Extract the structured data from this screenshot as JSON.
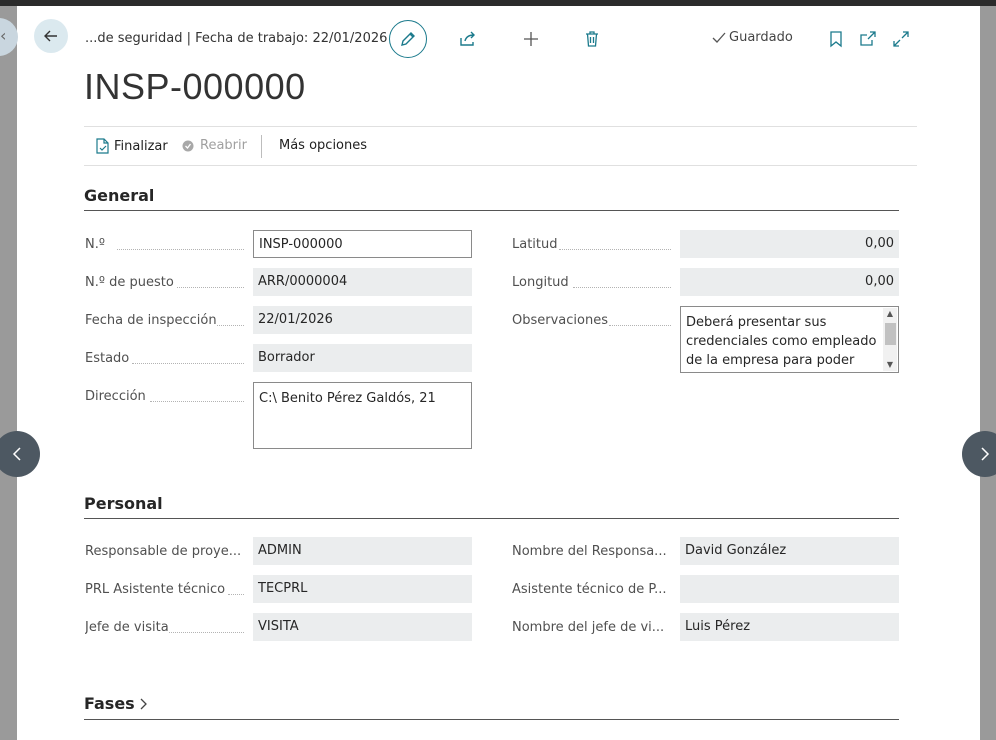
{
  "header": {
    "breadcrumb": "...de seguridad | Fecha de trabajo: 22/01/2026",
    "saved_label": "Guardado",
    "title": "INSP-000000"
  },
  "actions": {
    "finalize": "Finalizar",
    "reopen": "Reabrir",
    "more": "Más opciones"
  },
  "general": {
    "title": "General",
    "no_label": "N.º",
    "no_value": "INSP-000000",
    "post_label": "N.º de puesto",
    "post_value": "ARR/0000004",
    "date_label": "Fecha de inspección",
    "date_value": "22/01/2026",
    "state_label": "Estado",
    "state_value": "Borrador",
    "address_label": "Dirección",
    "address_value": "C:\\ Benito Pérez Galdós, 21",
    "lat_label": "Latitud",
    "lat_value": "0,00",
    "lon_label": "Longitud",
    "lon_value": "0,00",
    "obs_label": "Observaciones",
    "obs_value": "Deberá presentar sus credenciales como empleado de la empresa para poder"
  },
  "personal": {
    "title": "Personal",
    "resp_label": "Responsable de proye...",
    "resp_value": "ADMIN",
    "resp_name_label": "Nombre del Responsa...",
    "resp_name_value": "David González",
    "prl_label": "PRL Asistente técnico",
    "prl_value": "TECPRL",
    "assist_label": "Asistente técnico de P...",
    "assist_value": "",
    "boss_label": "Jefe de visita",
    "boss_value": "VISITA",
    "boss_name_label": "Nombre del jefe de vi...",
    "boss_name_value": "Luis Pérez"
  },
  "phases": {
    "title": "Fases"
  },
  "colors": {
    "accent": "#1b7a8c",
    "field_bg": "#ebedee",
    "nav_circle": "#4d5862"
  }
}
